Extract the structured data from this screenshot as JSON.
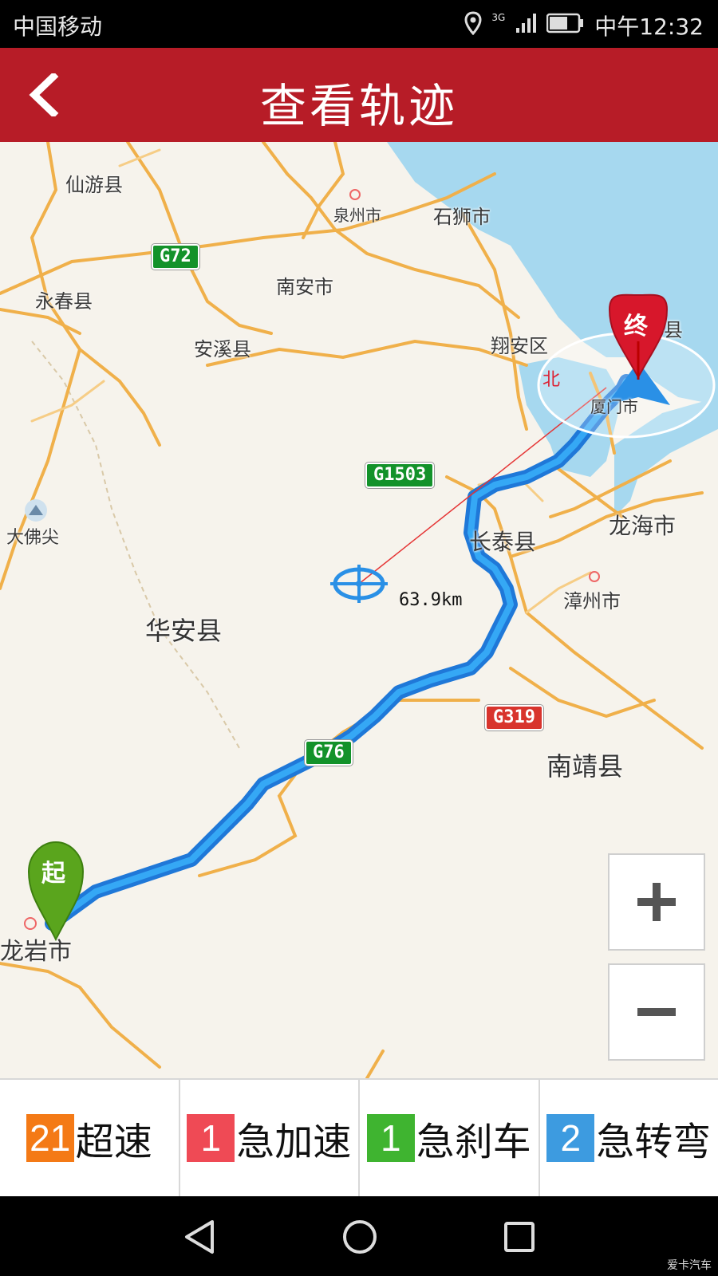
{
  "status_bar": {
    "carrier": "中国移动",
    "network": "3G",
    "time": "中午12:32"
  },
  "header": {
    "title": "查看轨迹"
  },
  "map": {
    "places": {
      "xianyou": "仙游县",
      "quanzhou": "泉州市",
      "shishi": "石狮市",
      "nanan": "南安市",
      "yongchun": "永春县",
      "anxi": "安溪县",
      "xiangan": "翔安区",
      "jinmen_partial": "县",
      "xiamen": "厦门市",
      "dafojian": "大佛尖",
      "changtai": "长泰县",
      "longhai": "龙海市",
      "zhangzhou": "漳州市",
      "huaan": "华安县",
      "nanjing": "南靖县",
      "longyan": "龙岩市"
    },
    "roads": {
      "g72": "G72",
      "g1503": "G1503",
      "g319": "G319",
      "g76": "G76"
    },
    "distance": "63.9km",
    "start_marker": "起",
    "end_marker": "终",
    "zoom_in": "+",
    "zoom_out": "−"
  },
  "stats": [
    {
      "count": "21",
      "label": "超速",
      "color": "#f47a16"
    },
    {
      "count": "1",
      "label": "急加速",
      "color": "#ef4a55"
    },
    {
      "count": "1",
      "label": "急刹车",
      "color": "#3fb430"
    },
    {
      "count": "2",
      "label": "急转弯",
      "color": "#3d9be0"
    }
  ],
  "watermark": "爱卡汽车"
}
